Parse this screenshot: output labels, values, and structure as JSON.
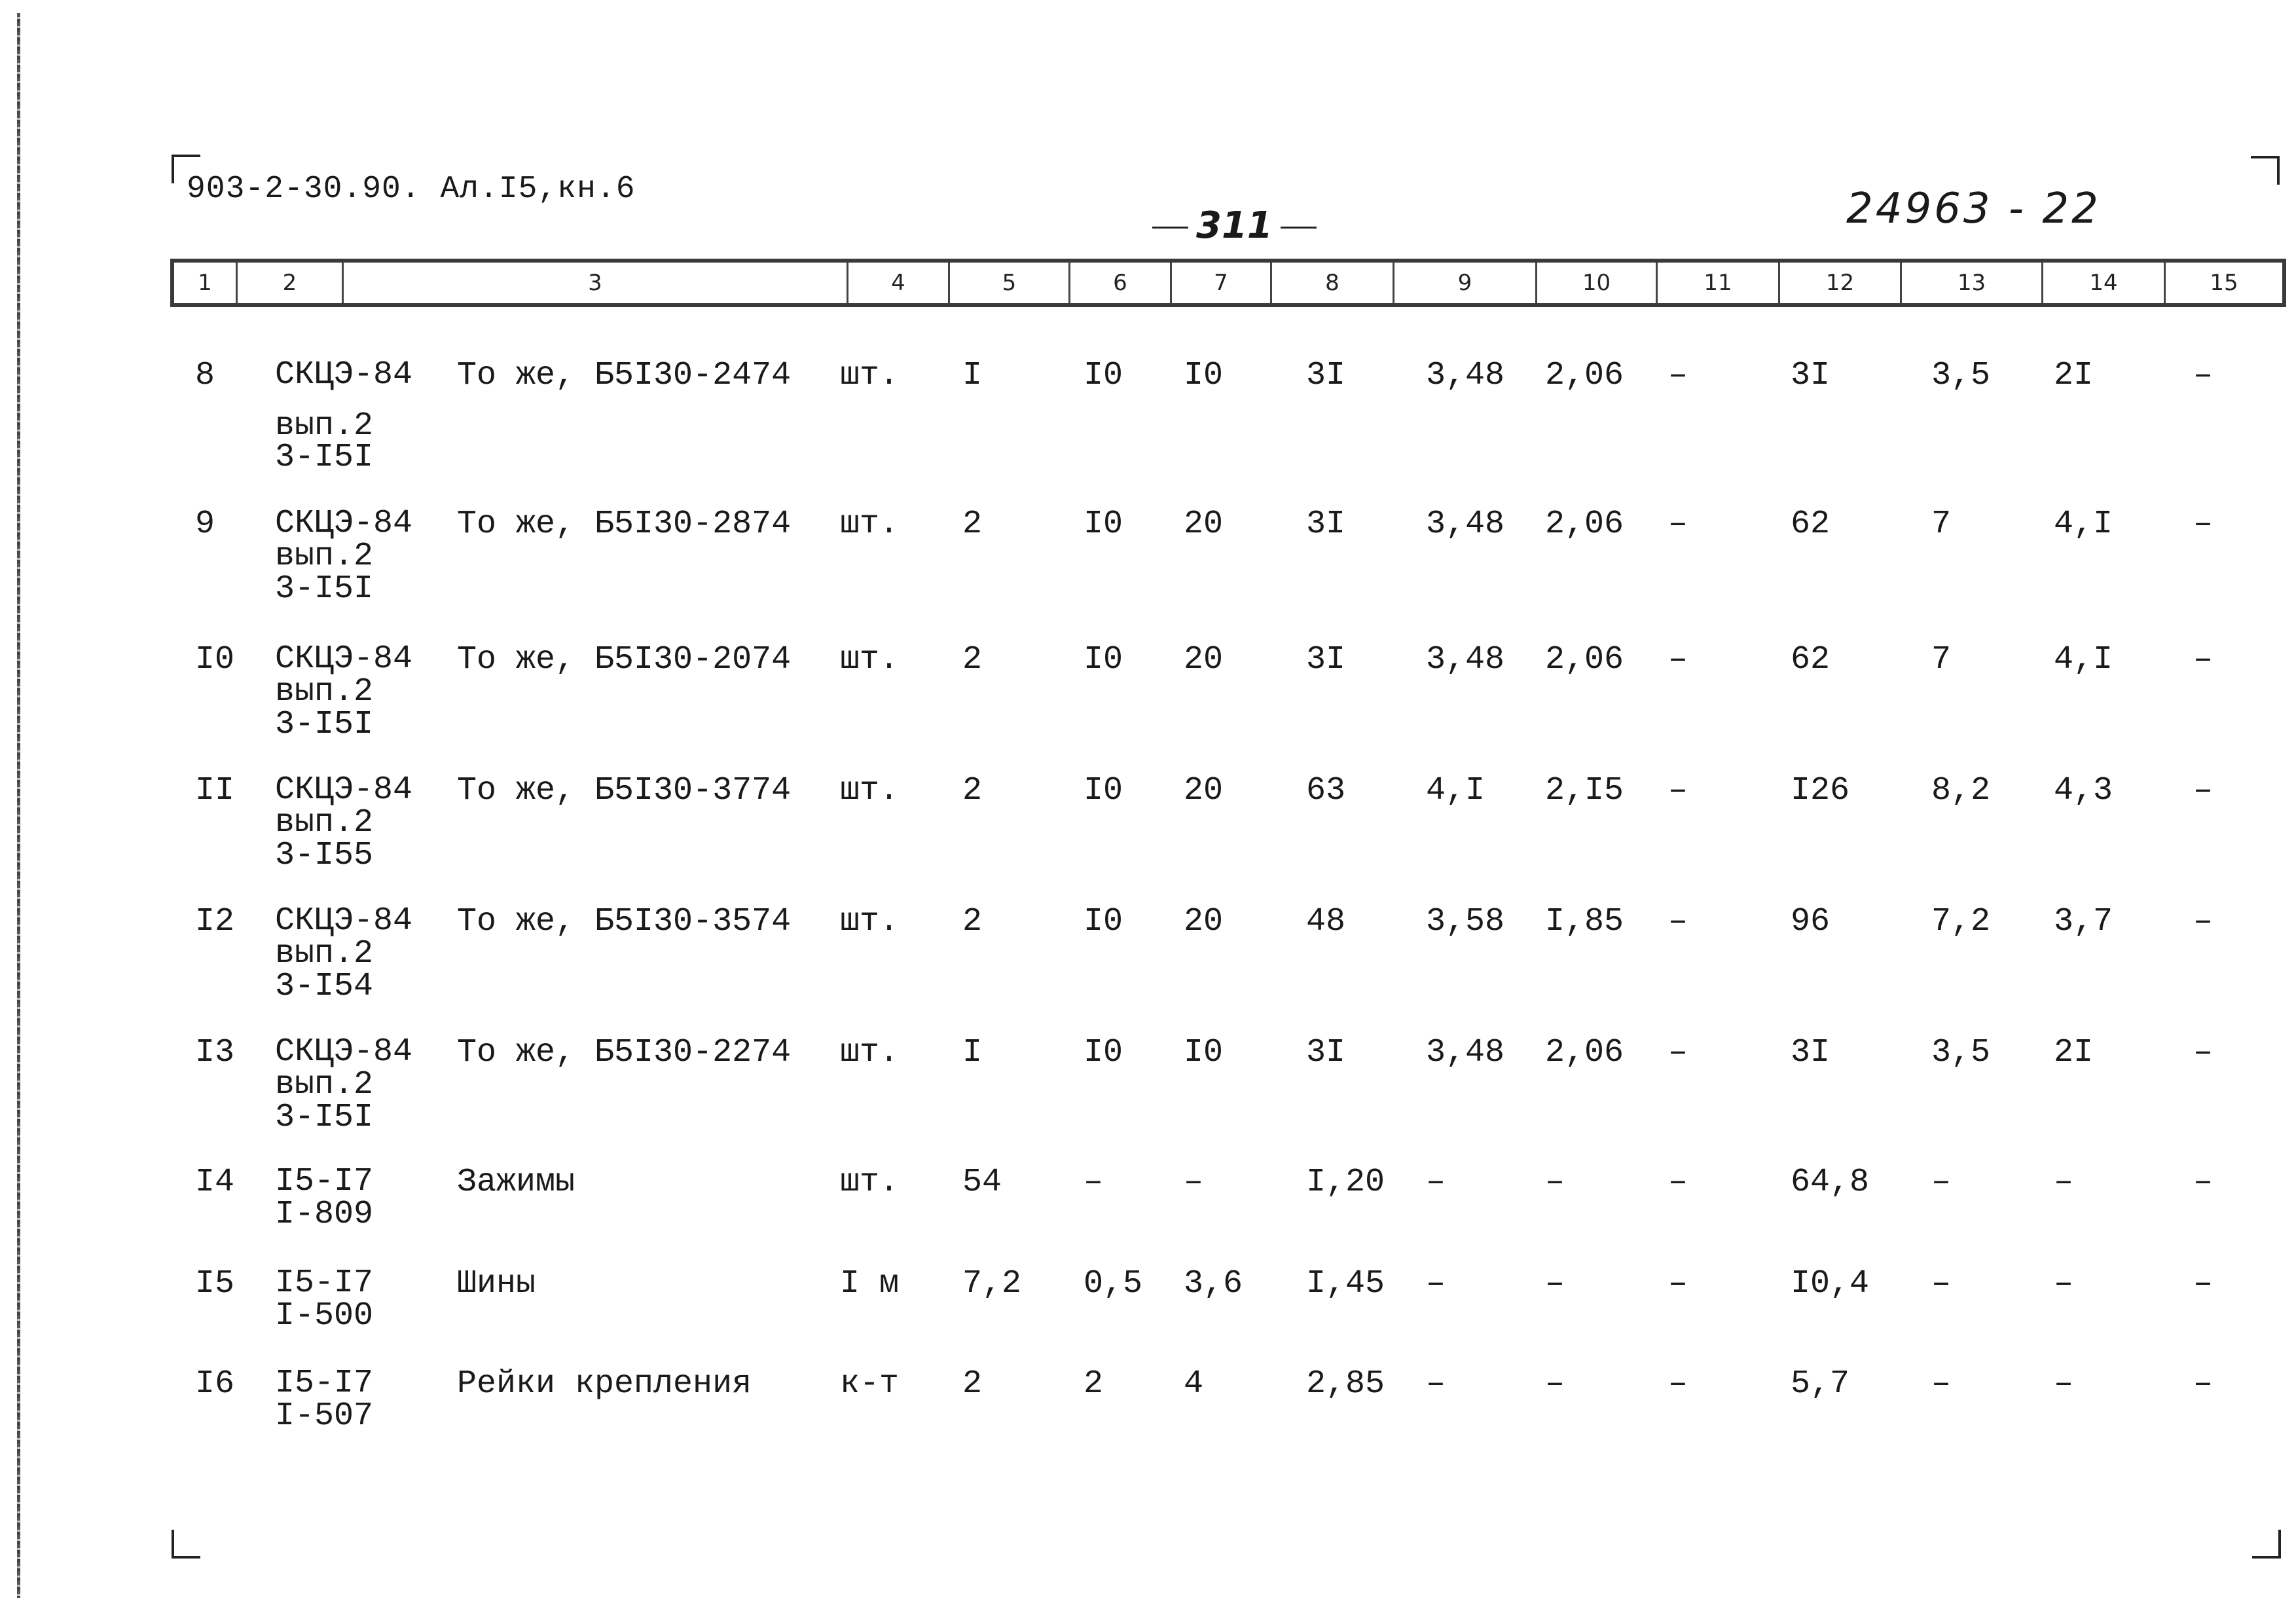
{
  "document": {
    "code": "903-2-30.90. Ал.I5,кн.6",
    "page_number": "311",
    "sheet_id": "24963 - 22"
  },
  "header": {
    "columns": [
      "1",
      "2",
      "3",
      "4",
      "5",
      "6",
      "7",
      "8",
      "9",
      "10",
      "11",
      "12",
      "13",
      "14",
      "15"
    ]
  },
  "rows": [
    {
      "c1": "8",
      "c2": [
        "СКЦЭ-84",
        "вып.2",
        "3-I5I"
      ],
      "c3": "То же, Б5I30-2474",
      "c4": "шт.",
      "c5": "I",
      "c6": "I0",
      "c7": "I0",
      "c8": "3I",
      "c9": "3,48",
      "c10": "2,06",
      "c11": "–",
      "c12": "3I",
      "c13": "3,5",
      "c14": "2I",
      "c15": "–"
    },
    {
      "c1": "9",
      "c2": [
        "СКЦЭ-84",
        "вып.2",
        "3-I5I"
      ],
      "c3": "То же, Б5I30-2874",
      "c4": "шт.",
      "c5": "2",
      "c6": "I0",
      "c7": "20",
      "c8": "3I",
      "c9": "3,48",
      "c10": "2,06",
      "c11": "–",
      "c12": "62",
      "c13": "7",
      "c14": "4,I",
      "c15": "–"
    },
    {
      "c1": "I0",
      "c2": [
        "СКЦЭ-84",
        "вып.2",
        "3-I5I"
      ],
      "c3": "То же, Б5I30-2074",
      "c4": "шт.",
      "c5": "2",
      "c6": "I0",
      "c7": "20",
      "c8": "3I",
      "c9": "3,48",
      "c10": "2,06",
      "c11": "–",
      "c12": "62",
      "c13": "7",
      "c14": "4,I",
      "c15": "–"
    },
    {
      "c1": "II",
      "c2": [
        "СКЦЭ-84",
        "вып.2",
        "3-I55"
      ],
      "c3": "То же, Б5I30-3774",
      "c4": "шт.",
      "c5": "2",
      "c6": "I0",
      "c7": "20",
      "c8": "63",
      "c9": "4,I",
      "c10": "2,I5",
      "c11": "–",
      "c12": "I26",
      "c13": "8,2",
      "c14": "4,3",
      "c15": "–"
    },
    {
      "c1": "I2",
      "c2": [
        "СКЦЭ-84",
        "вып.2",
        "3-I54"
      ],
      "c3": "То же, Б5I30-3574",
      "c4": "шт.",
      "c5": "2",
      "c6": "I0",
      "c7": "20",
      "c8": "48",
      "c9": "3,58",
      "c10": "I,85",
      "c11": "–",
      "c12": "96",
      "c13": "7,2",
      "c14": "3,7",
      "c15": "–"
    },
    {
      "c1": "I3",
      "c2": [
        "СКЦЭ-84",
        "вып.2",
        "3-I5I"
      ],
      "c3": "То же, Б5I30-2274",
      "c4": "шт.",
      "c5": "I",
      "c6": "I0",
      "c7": "I0",
      "c8": "3I",
      "c9": "3,48",
      "c10": "2,06",
      "c11": "–",
      "c12": "3I",
      "c13": "3,5",
      "c14": "2I",
      "c15": "–"
    },
    {
      "c1": "I4",
      "c2": [
        "I5-I7",
        "I-809"
      ],
      "c3": "Зажимы",
      "c4": "шт.",
      "c5": "54",
      "c6": "–",
      "c7": "–",
      "c8": "I,20",
      "c9": "–",
      "c10": "–",
      "c11": "–",
      "c12": "64,8",
      "c13": "–",
      "c14": "–",
      "c15": "–"
    },
    {
      "c1": "I5",
      "c2": [
        "I5-I7",
        "I-500"
      ],
      "c3": "Шины",
      "c4": "I м",
      "c5": "7,2",
      "c6": "0,5",
      "c7": "3,6",
      "c8": "I,45",
      "c9": "–",
      "c10": "–",
      "c11": "–",
      "c12": "I0,4",
      "c13": "–",
      "c14": "–",
      "c15": "–"
    },
    {
      "c1": "I6",
      "c2": [
        "I5-I7",
        "I-507"
      ],
      "c3": "Рейки крепления",
      "c4": "к-т",
      "c5": "2",
      "c6": "2",
      "c7": "4",
      "c8": "2,85",
      "c9": "–",
      "c10": "–",
      "c11": "–",
      "c12": "5,7",
      "c13": "–",
      "c14": "–",
      "c15": "–"
    }
  ]
}
